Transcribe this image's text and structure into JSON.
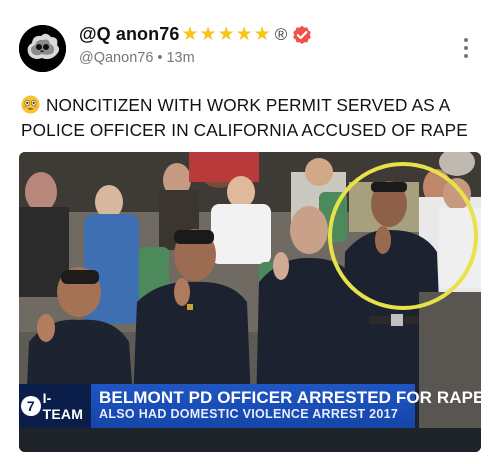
{
  "author": {
    "display_name": "@Q anon76",
    "handle": "@Qanon76",
    "time_ago": "13m",
    "star_count": 5,
    "registered_mark": "®",
    "verified_badge_color": "#f0504a",
    "star_color": "#f5c518"
  },
  "post": {
    "text": "NONCITIZEN WITH WORK PERMIT SERVED AS A POLICE OFFICER IN CALIFORNIA ACCUSED OF RAPE",
    "leading_emoji": "flushed-face"
  },
  "media": {
    "lower_third": {
      "station_mark": "7",
      "program": "I-TEAM",
      "headline": "BELMONT PD OFFICER ARRESTED FOR RAPE",
      "subhead": "ALSO HAD DOMESTIC VIOLENCE ARREST 2017"
    },
    "highlight_ring_color": "#e8e24a"
  },
  "icons": {
    "avatar": "skull-in-smoke-avatar",
    "more": "more-vertical-icon",
    "badge": "verified-check-badge"
  }
}
